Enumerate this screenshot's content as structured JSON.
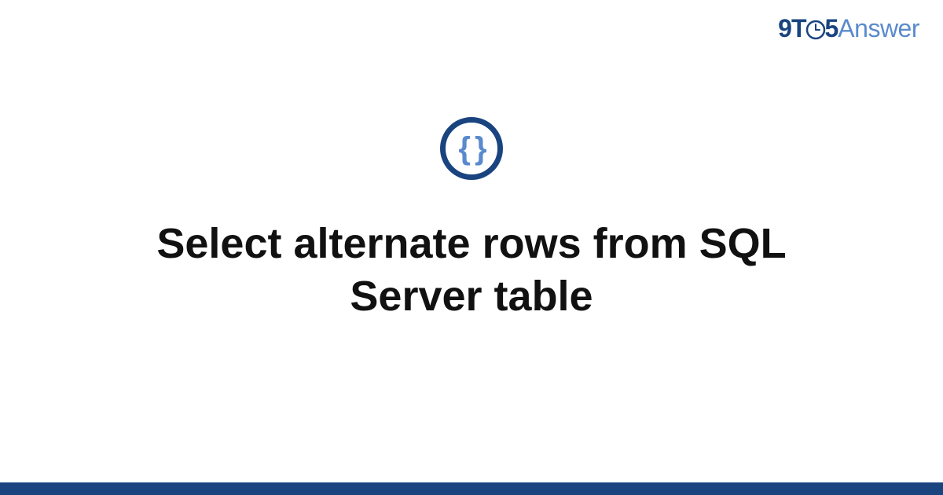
{
  "brand": {
    "part1": "9T",
    "part2": "5",
    "part3": "Answer"
  },
  "icon": {
    "name": "code-braces",
    "glyph": "{ }"
  },
  "title": "Select alternate rows from SQL Server table",
  "colors": {
    "primary": "#1a4480",
    "accent": "#5a8acd"
  }
}
